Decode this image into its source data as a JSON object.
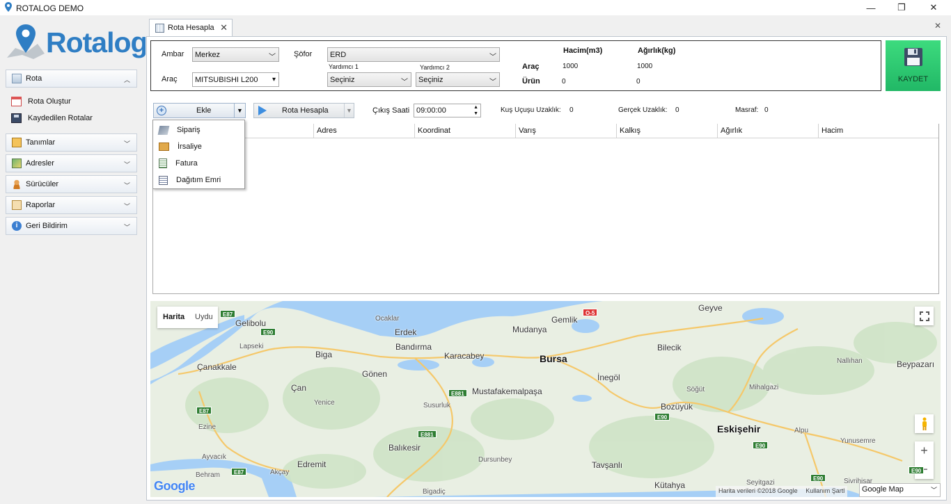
{
  "window": {
    "title": "ROTALOG DEMO",
    "minimize": "—",
    "maximize": "❐",
    "close": "✕"
  },
  "sidebar": {
    "logo": "Rotalog",
    "rota": {
      "label": "Rota",
      "items": [
        {
          "label": "Rota Oluştur"
        },
        {
          "label": "Kaydedilen Rotalar"
        }
      ]
    },
    "sections": [
      {
        "label": "Tanımlar"
      },
      {
        "label": "Adresler"
      },
      {
        "label": "Sürücüler"
      },
      {
        "label": "Raporlar"
      },
      {
        "label": "Geri Bildirim"
      }
    ]
  },
  "tab": {
    "label": "Rota Hesapla",
    "close": "✕"
  },
  "content_close": "✕",
  "form": {
    "ambar_label": "Ambar",
    "ambar_value": "Merkez",
    "arac_label": "Araç",
    "arac_value": "MITSUBISHI L200",
    "sofor_label": "Şöfor",
    "sofor_value": "ERD",
    "yardimci1_label": "Yardımcı 1",
    "yardimci1_value": "Seçiniz",
    "yardimci2_label": "Yardımcı 2",
    "yardimci2_value": "Seçiniz"
  },
  "summary": {
    "hacim_header": "Hacim(m3)",
    "agirlik_header": "Ağırlık(kg)",
    "arac_label": "Araç",
    "arac_hacim": "1000",
    "arac_agirlik": "1000",
    "urun_label": "Ürün",
    "urun_hacim": "0",
    "urun_agirlik": "0"
  },
  "save_label": "KAYDET",
  "toolbar": {
    "ekle_label": "Ekle",
    "rota_hesapla_label": "Rota Hesapla",
    "cikis_saati_label": "Çıkış Saati",
    "cikis_saati_value": "09:00:00",
    "kus_label": "Kuş Uçuşu Uzaklık:",
    "kus_value": "0",
    "gercek_label": "Gerçek Uzaklık:",
    "gercek_value": "0",
    "masraf_label": "Masraf:",
    "masraf_value": "0"
  },
  "grid": {
    "columns": [
      "Adres",
      "Koordinat",
      "Varış",
      "Kalkış",
      "Ağırlık",
      "Hacim"
    ]
  },
  "menu": {
    "items": [
      {
        "label": "Sipariş"
      },
      {
        "label": "İrsaliye"
      },
      {
        "label": "Fatura"
      },
      {
        "label": "Dağıtım Emri"
      }
    ]
  },
  "map": {
    "type_map": "Harita",
    "type_satellite": "Uydu",
    "attribution": "Harita verileri ©2018 Google",
    "terms": "Kullanım Şartl",
    "provider_select": "Google Map",
    "google_logo": "Google",
    "zoom_in": "+",
    "zoom_out": "−",
    "places": [
      "Geyve",
      "Gelibolu",
      "Ocaklar",
      "Gemlik",
      "Erdek",
      "Mudanya",
      "Lapseki",
      "Bandırma",
      "Biga",
      "Karacabey",
      "Bursa",
      "Bilecik",
      "Nallıhan",
      "Beypazarı",
      "Çanakkale",
      "Gönen",
      "İnegöl",
      "Söğüt",
      "Mihalgazi",
      "Çan",
      "Mustafakemalpaşa",
      "Yenice",
      "Susurluk",
      "Bozüyük",
      "Ezine",
      "Eskişehir",
      "Alpu",
      "Balıkesir",
      "Yunusemre",
      "Ayvacık",
      "Edremit",
      "Dursunbey",
      "Tavşanlı",
      "Akçay",
      "Behram",
      "Seyitgazi",
      "Sivrihisar",
      "Kütahya",
      "Bigadiç"
    ],
    "roads": [
      "E87",
      "E90",
      "O-5",
      "E881",
      "E90",
      "E90",
      "E881",
      "E87",
      "E87",
      "E90",
      "E90"
    ]
  },
  "colors": {
    "accent": "#2f7ec4",
    "save": "#27c26c",
    "water": "#a6cff6",
    "land": "#e8efe3"
  }
}
